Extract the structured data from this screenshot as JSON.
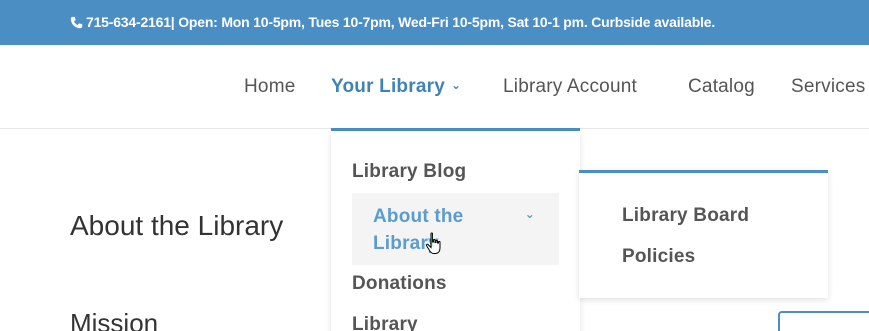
{
  "topbar": {
    "text": "715-634-2161| Open: Mon 10-5pm, Tues 10-7pm, Wed-Fri 10-5pm, Sat 10-1 pm. Curbside available."
  },
  "nav": {
    "home": "Home",
    "your_library": "Your Library",
    "library_account": "Library Account",
    "catalog": "Catalog",
    "services": "Services"
  },
  "dropdown": {
    "items": [
      "Library Blog",
      "About the Library",
      "Donations",
      "Library"
    ]
  },
  "submenu": {
    "items": [
      "Library Board",
      "Policies"
    ]
  },
  "content": {
    "title": "About the Library",
    "mission": "Mission"
  },
  "colors": {
    "accent": "#4a8ec3",
    "active_text": "#3f83b8"
  },
  "icons": [
    "phone-icon",
    "chevron-down-icon",
    "hand-pointer-cursor-icon"
  ]
}
